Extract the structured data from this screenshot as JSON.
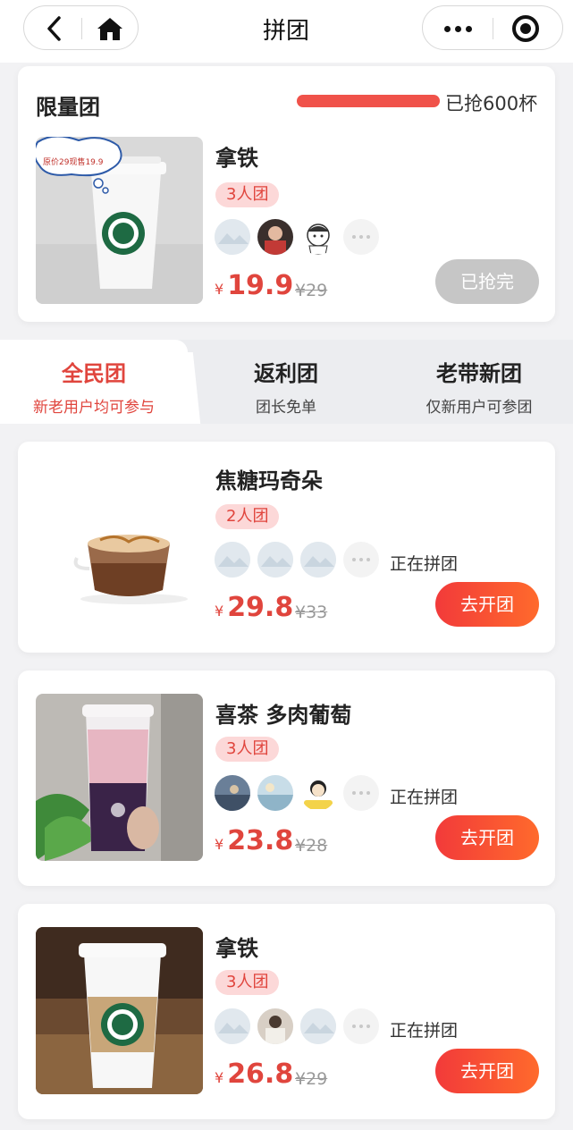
{
  "nav": {
    "title": "拼团"
  },
  "limited": {
    "title": "限量团",
    "sold_text": "已抢600杯",
    "progress": 1.0,
    "product": {
      "image_badge": "原价29现售19.9",
      "name": "拿铁",
      "group_tag": "3人团",
      "currency": "¥",
      "price": "19.9",
      "original_price": "¥29",
      "button_label": "已抢完"
    }
  },
  "tabs": [
    {
      "label": "全民团",
      "sub": "新老用户均可参与",
      "active": true
    },
    {
      "label": "返利团",
      "sub": "团长免单",
      "active": false
    },
    {
      "label": "老带新团",
      "sub": "仅新用户可参团",
      "active": false
    }
  ],
  "items": [
    {
      "name": "焦糖玛奇朵",
      "group_tag": "2人团",
      "status": "正在拼团",
      "currency": "¥",
      "price": "29.8",
      "original_price": "¥33",
      "button_label": "去开团"
    },
    {
      "name": "喜茶 多肉葡萄",
      "group_tag": "3人团",
      "status": "正在拼团",
      "currency": "¥",
      "price": "23.8",
      "original_price": "¥28",
      "button_label": "去开团"
    },
    {
      "name": "拿铁",
      "group_tag": "3人团",
      "status": "正在拼团",
      "currency": "¥",
      "price": "26.8",
      "original_price": "¥29",
      "button_label": "去开团"
    }
  ],
  "colors": {
    "accent": "#e0453d",
    "tag_bg": "#fcd8d8",
    "sold_button": "#c6c6c6",
    "background": "#f2f2f4"
  }
}
